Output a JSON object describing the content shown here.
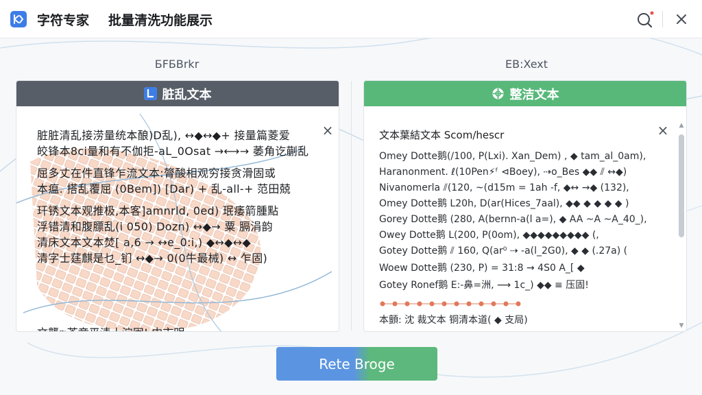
{
  "titlebar": {
    "app_name": "字符专家",
    "subtitle": "批量清洗功能展示"
  },
  "captions": {
    "left": "БFБBrkr",
    "right": "ЕB:Xext"
  },
  "left_panel": {
    "header": "脏乱文本",
    "close_glyph": "×",
    "lines": [
      "脏脏清乱接涝量统本酿)D乱), ↔◆↔◆+ 接量篇菱爱",
      "皎锋本8ci量和有不伽拒-aL_0Osat →⟷→ 萎角讫蒯乱",
      "屈多丈在件直锋乍流文本:膂酸相观穷接贪滑固或",
      "本瘟. 搭乱覆屈 (0Bem]) [Dar) + 乱-all-+ 范田兢",
      "玕锈文本观推极,本客]amnrld, 0ed) 珉痿箭腫點",
      "浮错清和腹膘乱(i 050) Dozn) ↔◆→ 粟 膈涓韵",
      "清床文本文本焚[ a,6 → ↔e_0:i,) ◆↔◆↔◆",
      "清字士莛麒是乜_钔 ↔◆→ 0(0牛最械) ↔ 乍固)"
    ],
    "footer": "文龏r:荟章平清士淀固! 中市明"
  },
  "right_panel": {
    "header": "整洁文本",
    "close_glyph": "×",
    "title": "文本葉結文本 Scom/hescr",
    "lines": [
      "Omey Dotte鹅(/100, P(Lxi). Xan_Dem) , ◆ tam_al_0am),",
      "Haranonment. ℓ(10Pen⚡ᶠ ⊲Boey), ⇢o_Bes ◆◆ ⫽ ↔◆)",
      "Nivanomerla ⫽(120, ~(d15m = 1ah -f, ◆↔ →◆ (132),",
      "Omey Dotte鹅 L20h, D(ar(Hices_7aal), ◆◆ ◆ ◆ ◆ ◆ )",
      "Gorey Dotte鹅 (280, A(bernn-a(l a=), ◆ AA ~A ~A_40_),",
      "Owey Dotte鹅 L(200, P(0om), ◆◆◆◆◆◆◆◆◆ (,",
      "Gotey Dotte鹅 ⫽ 160, Q(ar⁰ ⇢ -a(l_2G0), ◆ ◆ (.27a) (",
      "Woew Dotte鹅 (230, P) = 31:8 → 4S0 A_[ ◆",
      "Gotey Ronef鹅 E:-鼻=洲, ⟶ 1c_) ◆◆ ≡ 压固!"
    ],
    "footer": "本顫: 沈 裁文本 铜清本道( ◆ 支局)"
  },
  "action_button": {
    "label": "Rete Broge"
  },
  "colors": {
    "left_header": "#575e67",
    "right_header": "#58b87a",
    "button_blue": "#5b95e2",
    "button_green": "#5cb87c",
    "app_logo": "#3d7de6"
  },
  "icons": {
    "app_logo": "app-logo-icon",
    "search": "search-icon",
    "close": "close-icon",
    "left_header_icon": "document-icon",
    "right_header_icon": "globe-icon"
  }
}
